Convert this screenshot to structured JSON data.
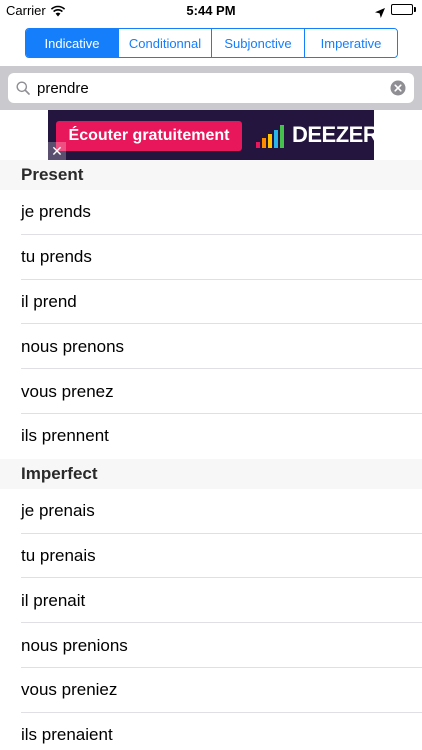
{
  "status_bar": {
    "carrier": "Carrier",
    "time": "5:44 PM",
    "battery_level": 1.0
  },
  "tense_selector": {
    "segments": [
      {
        "label": "Indicative",
        "selected": true
      },
      {
        "label": "Conditionnal",
        "selected": false
      },
      {
        "label": "Subjonctive",
        "selected": false
      },
      {
        "label": "Imperative",
        "selected": false
      }
    ]
  },
  "search": {
    "value": "prendre",
    "icon": "search-icon",
    "clear_icon": "clear-icon"
  },
  "ad": {
    "cta": "Écouter gratuitement",
    "brand": "DEEZER",
    "close_label": "✕"
  },
  "sections": [
    {
      "title": "Present",
      "rows": [
        "je prends",
        "tu prends",
        "il prend",
        "nous prenons",
        "vous prenez",
        "ils prennent"
      ]
    },
    {
      "title": "Imperfect",
      "rows": [
        "je prenais",
        "tu prenais",
        "il prenait",
        "nous prenions",
        "vous preniez",
        "ils prenaient"
      ]
    }
  ],
  "colors": {
    "accent": "#157efb",
    "search_bar_bg": "#c9c9ce",
    "section_header_bg": "#f7f7f7",
    "ad_bg": "#23153e",
    "ad_cta_bg": "#e8165a"
  }
}
